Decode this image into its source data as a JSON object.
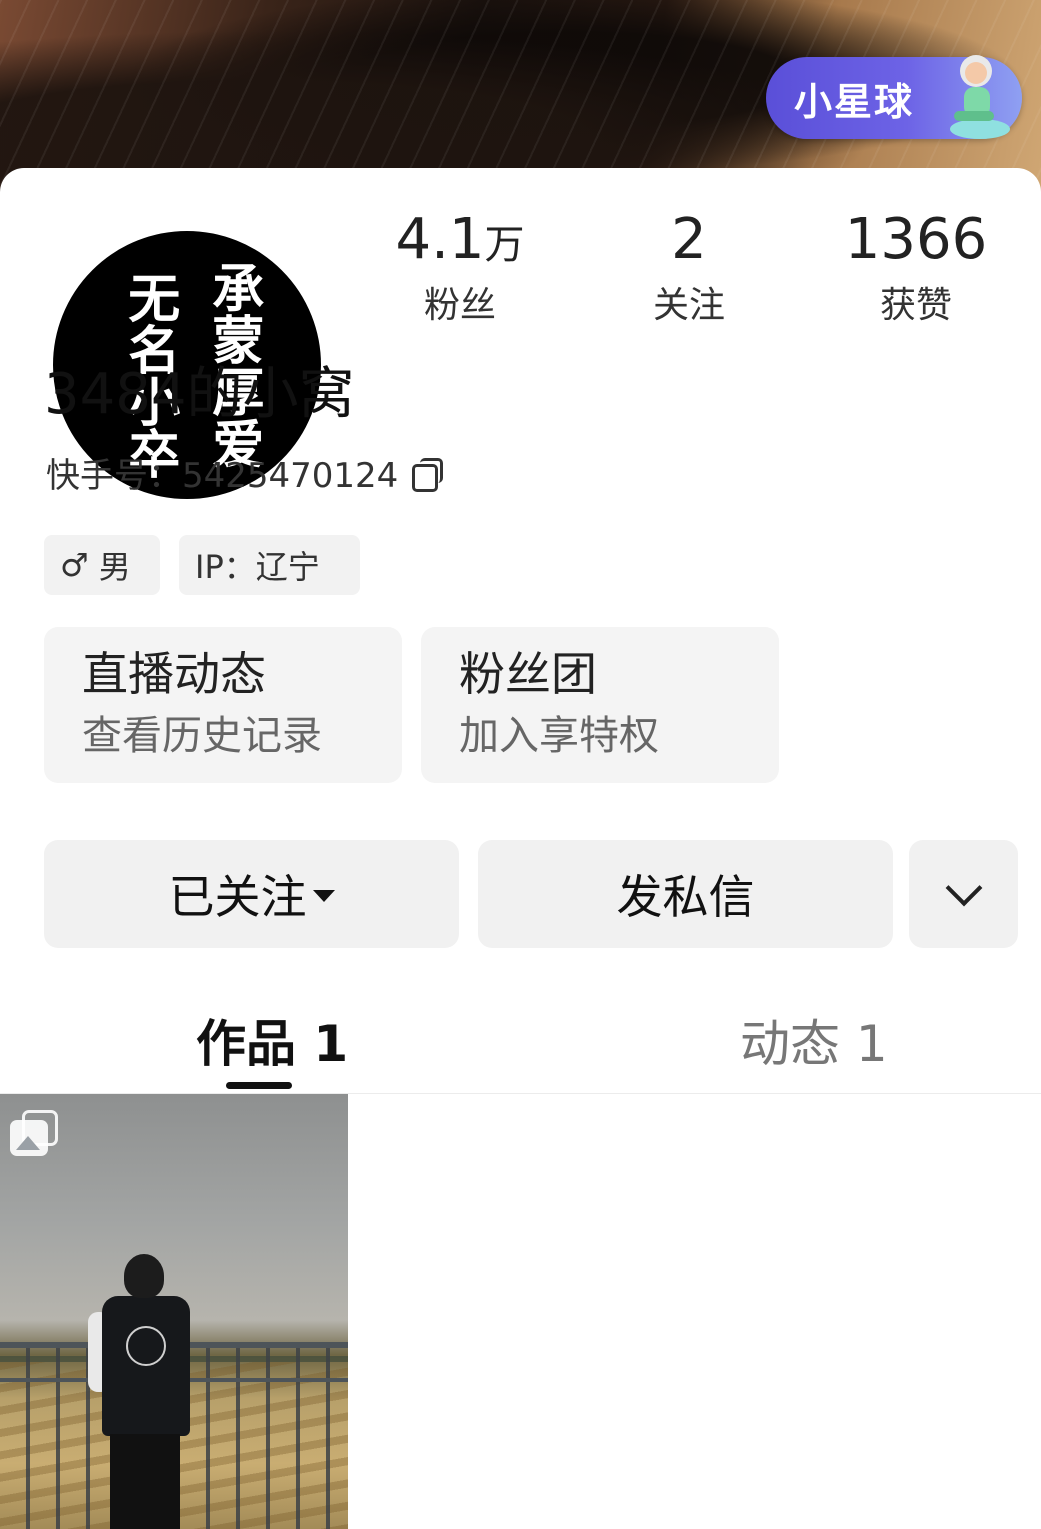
{
  "badge": {
    "label": "小星球"
  },
  "avatar": {
    "calligraphy_left": "无名小卒",
    "calligraphy_right": "承蒙厚爱"
  },
  "stats": [
    {
      "num": "4.1",
      "unit": "万",
      "label": "粉丝"
    },
    {
      "num": "2",
      "unit": "",
      "label": "关注"
    },
    {
      "num": "1366",
      "unit": "",
      "label": "获赞"
    }
  ],
  "profile": {
    "name": "3484的小窝",
    "kuaishou_id_label": "快手号：",
    "kuaishou_id": "5425470124"
  },
  "tags": {
    "gender_symbol": "♂",
    "gender": "男",
    "ip": "IP：辽宁"
  },
  "cards": [
    {
      "title": "直播动态",
      "subtitle": "查看历史记录"
    },
    {
      "title": "粉丝团",
      "subtitle": "加入享特权"
    }
  ],
  "actions": {
    "followed": "已关注",
    "message": "发私信"
  },
  "tabs": [
    {
      "label": "作品 1",
      "active": true
    },
    {
      "label": "动态 1",
      "active": false
    }
  ],
  "colors": {
    "badge_start": "#5a4fd8",
    "badge_end": "#8fa0f2",
    "button_bg": "#f1f1f1"
  }
}
